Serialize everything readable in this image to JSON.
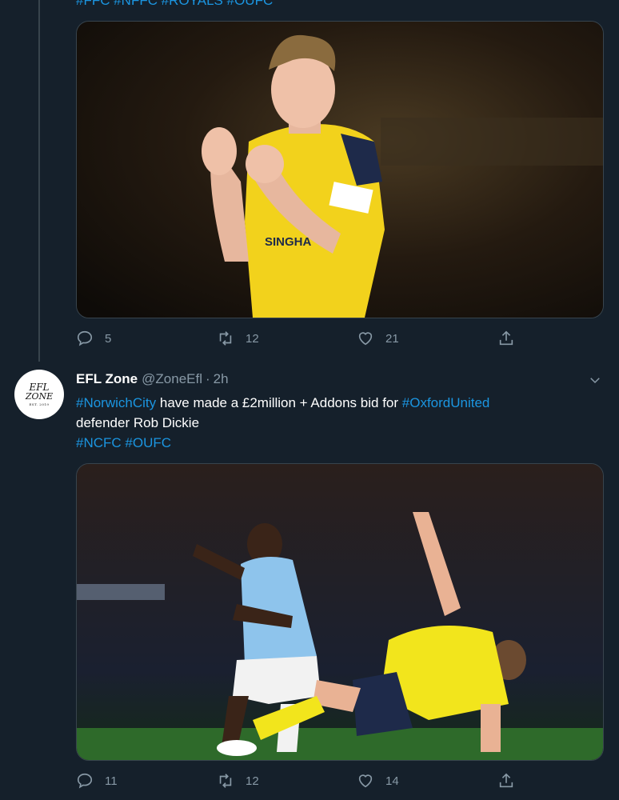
{
  "previous_tweet": {
    "hashtags_line": "#FFC #NFFC #ROYALS #OUFC",
    "image_alt": "Oxford United player applauding in yellow kit",
    "actions": {
      "replies": "5",
      "retweets": "12",
      "likes": "21"
    }
  },
  "tweet": {
    "avatar": {
      "line1": "EFL",
      "line2": "ZONE",
      "line3": "EST. 2019"
    },
    "display_name": "EFL Zone",
    "handle": "@ZoneEfl",
    "separator": "·",
    "time": "2h",
    "text": {
      "hashtag1": "#NorwichCity",
      "part1": " have made a £2million + Addons bid for ",
      "hashtag2": "#OxfordUnited",
      "part2": "defender Rob Dickie",
      "hashtag3": "#NCFC",
      "hashtag4": "#OUFC"
    },
    "image_alt": "Oxford United defender tackling Manchester City player",
    "actions": {
      "replies": "11",
      "retweets": "12",
      "likes": "14"
    }
  },
  "colors": {
    "background": "#15202b",
    "accent": "#1b95e0",
    "muted": "#8899a6",
    "border": "#38444d"
  },
  "icons": [
    "reply-icon",
    "retweet-icon",
    "like-icon",
    "share-icon",
    "chevron-down-icon"
  ]
}
